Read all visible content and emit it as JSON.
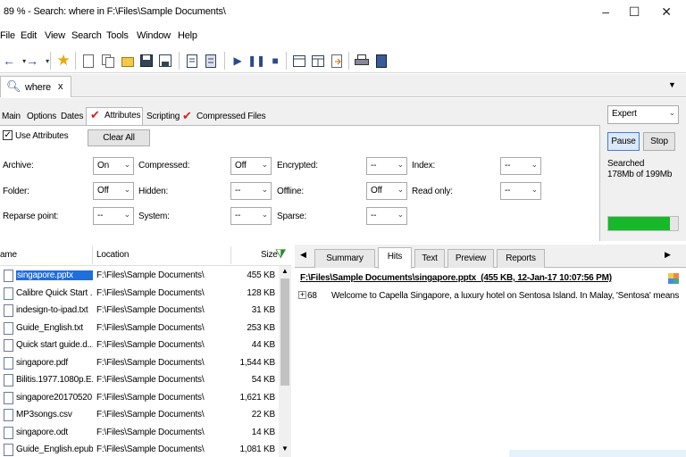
{
  "window": {
    "title": "89 % - Search: where in F:\\Files\\Sample Documents\\",
    "minimize": "–",
    "maximize": "☐",
    "close": "✕"
  },
  "menu": [
    "File",
    "Edit",
    "View",
    "Search",
    "Tools",
    "Window",
    "Help"
  ],
  "search_tab": {
    "label": "where",
    "close": "x"
  },
  "dropdown_arrow": "▼",
  "option_tabs": [
    {
      "label": "Main"
    },
    {
      "label": "Options"
    },
    {
      "label": "Dates"
    },
    {
      "label": "Attributes",
      "checked": true
    },
    {
      "label": "Scripting"
    },
    {
      "label": "Compressed Files",
      "checked": true
    }
  ],
  "attributes": {
    "use_attributes_label": "Use Attributes",
    "clear_all": "Clear All",
    "fields": [
      {
        "label": "Archive:",
        "value": "On"
      },
      {
        "label": "Compressed:",
        "value": "Off"
      },
      {
        "label": "Encrypted:",
        "value": "--"
      },
      {
        "label": "Index:",
        "value": "--"
      },
      {
        "label": "Folder:",
        "value": "Off"
      },
      {
        "label": "Hidden:",
        "value": "--"
      },
      {
        "label": "Offline:",
        "value": "Off"
      },
      {
        "label": "Read only:",
        "value": "--"
      },
      {
        "label": "Reparse point:",
        "value": "--"
      },
      {
        "label": "System:",
        "value": "--"
      },
      {
        "label": "Sparse:",
        "value": "--"
      }
    ]
  },
  "status_panel": {
    "mode": "Expert",
    "pause": "Pause",
    "stop": "Stop",
    "searched_line1": "Searched",
    "searched_line2": "178Mb of 199Mb",
    "progress_fraction": 0.89
  },
  "file_list": {
    "columns": [
      "ame",
      "Location",
      "Size"
    ],
    "rows": [
      {
        "name": "singapore.pptx",
        "location": "F:\\Files\\Sample Documents\\",
        "size": "455 KB",
        "selected": true
      },
      {
        "name": "Calibre Quick Start ...",
        "location": "F:\\Files\\Sample Documents\\",
        "size": "128 KB"
      },
      {
        "name": "indesign-to-ipad.txt",
        "location": "F:\\Files\\Sample Documents\\",
        "size": "31 KB"
      },
      {
        "name": "Guide_English.txt",
        "location": "F:\\Files\\Sample Documents\\",
        "size": "253 KB"
      },
      {
        "name": "Quick start guide.d...",
        "location": "F:\\Files\\Sample Documents\\",
        "size": "44 KB"
      },
      {
        "name": "singapore.pdf",
        "location": "F:\\Files\\Sample Documents\\",
        "size": "1,544 KB"
      },
      {
        "name": "Bilitis.1977.1080p.E...",
        "location": "F:\\Files\\Sample Documents\\",
        "size": "54 KB"
      },
      {
        "name": "singapore20170520...",
        "location": "F:\\Files\\Sample Documents\\",
        "size": "1,621 KB"
      },
      {
        "name": "MP3songs.csv",
        "location": "F:\\Files\\Sample Documents\\",
        "size": "22 KB"
      },
      {
        "name": "singapore.odt",
        "location": "F:\\Files\\Sample Documents\\",
        "size": "14 KB"
      },
      {
        "name": "Guide_English.epub",
        "location": "F:\\Files\\Sample Documents\\",
        "size": "1,081 KB"
      }
    ]
  },
  "preview": {
    "tabs": [
      "Summary",
      "Hits",
      "Text",
      "Preview",
      "Reports"
    ],
    "active_tab": "Hits",
    "left_arrow": "◀",
    "right_arrow": "▶",
    "file_header": "F:\\Files\\Sample Documents\\singapore.pptx  (455 KB, 12-Jan-17 10:07:56 PM)",
    "hit_expand": "+",
    "hit_count": "68",
    "hit_text": "Welcome to Capella Singapore, a luxury hotel on Sentosa Island. In Malay, 'Sentosa' means"
  },
  "colors": {
    "selection": "#1e6fd9",
    "progress": "#17b82a",
    "check": "#d42020"
  }
}
